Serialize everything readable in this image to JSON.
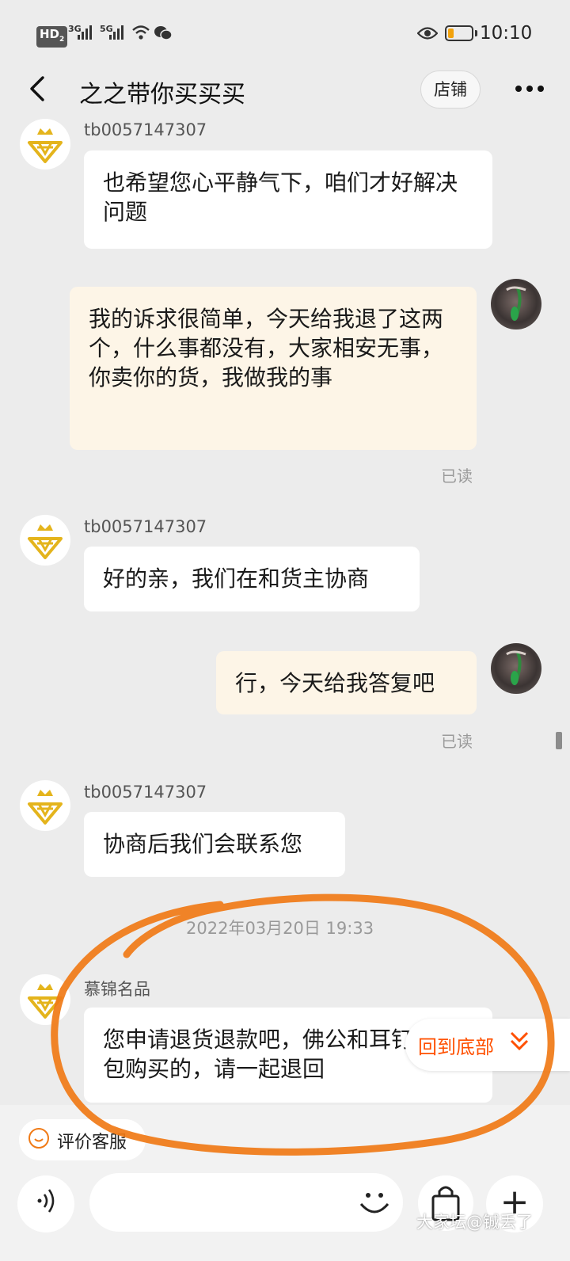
{
  "status_bar": {
    "hd": "HD",
    "hd_sub": "2",
    "net1": "3G",
    "net2": "5G",
    "time": "10:10",
    "battery_level": 0.25,
    "battery_color": "#f2a20d"
  },
  "nav": {
    "title": "之之带你买买买",
    "store_button": "店铺",
    "back_icon": "chevron-left-icon",
    "more_icon": "more-dots-icon"
  },
  "messages": [
    {
      "side": "in",
      "sender": "tb0057147307",
      "text": "也希望您心平静气下，咱们才好解决问题"
    },
    {
      "side": "out",
      "text": "我的诉求很简单，今天给我退了这两个，什么事都没有，大家相安无事，你卖你的货，我做我的事",
      "status": "已读"
    },
    {
      "side": "in",
      "sender": "tb0057147307",
      "text": "好的亲，我们在和货主协商"
    },
    {
      "side": "out",
      "text": "行，今天给我答复吧",
      "status": "已读"
    },
    {
      "side": "in",
      "sender": "tb0057147307",
      "text": "协商后我们会联系您"
    },
    {
      "timestamp": "2022年03月20日 19:33"
    },
    {
      "side": "in",
      "sender": "慕锦名品",
      "text": "您申请退货退款吧，佛公和耳钉是打包购买的，请一起退回"
    }
  ],
  "back_to_bottom": {
    "label": "回到底部",
    "icon": "double-chevron-down-icon"
  },
  "footer": {
    "rate_label": "评价客服",
    "input_placeholder": "",
    "icons": [
      "voice-icon",
      "emoji-icon",
      "shopping-bag-icon",
      "plus-icon"
    ]
  },
  "watermark": "大家坛@铖丢了",
  "colors": {
    "accent": "#ff5000",
    "annotation": "#f07a16",
    "outgoing_bubble": "#fdf5e7",
    "logo_gold": "#e4b41c"
  }
}
